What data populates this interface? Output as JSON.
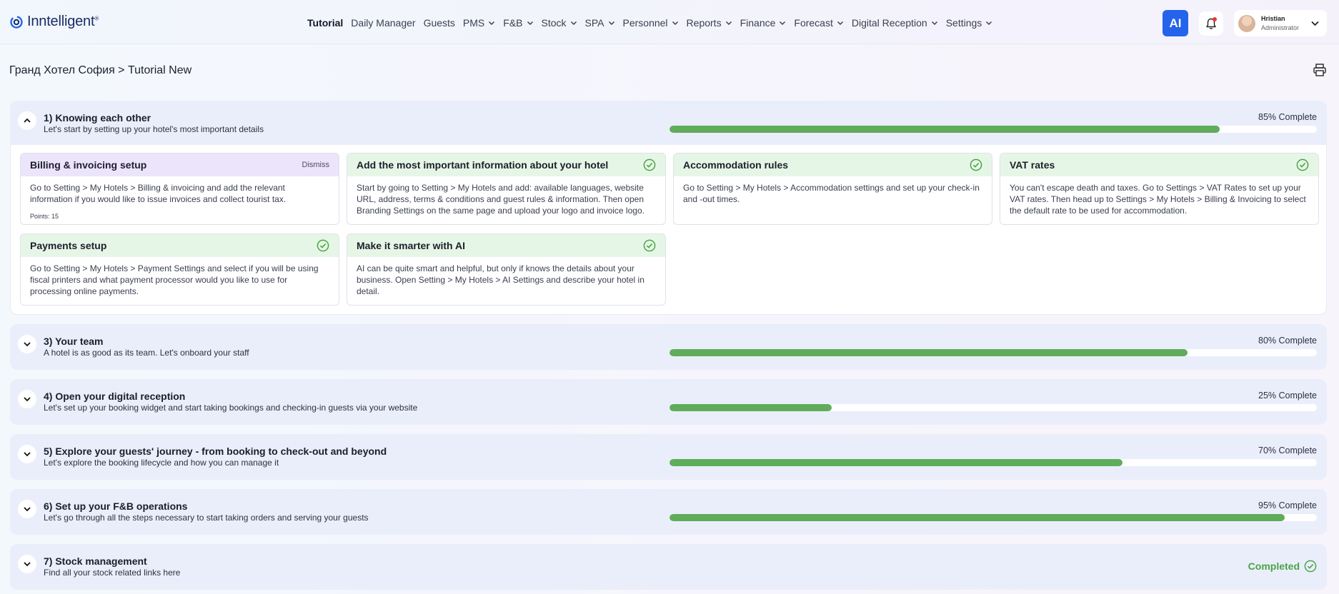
{
  "app": {
    "logo_text": "Inntelligent",
    "logo_mark": "®",
    "nav": [
      {
        "label": "Tutorial",
        "dropdown": false,
        "active": true
      },
      {
        "label": "Daily Manager",
        "dropdown": false
      },
      {
        "label": "Guests",
        "dropdown": false
      },
      {
        "label": "PMS",
        "dropdown": true
      },
      {
        "label": "F&B",
        "dropdown": true
      },
      {
        "label": "Stock",
        "dropdown": true
      },
      {
        "label": "SPA",
        "dropdown": true
      },
      {
        "label": "Personnel",
        "dropdown": true
      },
      {
        "label": "Reports",
        "dropdown": true
      },
      {
        "label": "Finance",
        "dropdown": true
      },
      {
        "label": "Forecast",
        "dropdown": true
      },
      {
        "label": "Digital Reception",
        "dropdown": true
      },
      {
        "label": "Settings",
        "dropdown": true
      }
    ],
    "ai_label": "AI",
    "user": {
      "name": "Hristian",
      "role": "Administrator"
    }
  },
  "page": {
    "breadcrumb": "Гранд Хотел София > Tutorial New"
  },
  "colors": {
    "progress_fill": "#5fac5b",
    "accent_blue": "#2563eb",
    "done_green": "#4aa546",
    "pending_purple": "#ece4fa"
  },
  "sections": [
    {
      "title": "1) Knowing each other",
      "subtitle": "Let's start by setting up your hotel's most important details",
      "progress_label": "85% Complete",
      "progress": 0.85,
      "expanded": true,
      "cards": [
        {
          "title": "Billing & invoicing setup",
          "body": "Go to Setting > My Hotels > Billing & invoicing and add the relevant information if you would like to issue invoices and collect tourist tax.",
          "points": "Points: 15",
          "dismiss": "Dismiss",
          "done": false
        },
        {
          "title": "Add the most important information about your hotel",
          "body": "Start by going to Setting > My Hotels and add: available languages, website URL, address, terms & conditions and guest rules & information. Then open Branding Settings on the same page and upload your logo and invoice logo.",
          "done": true
        },
        {
          "title": "Accommodation rules",
          "body": "Go to Setting > My Hotels > Accommodation settings and set up your check-in and -out times.",
          "done": true
        },
        {
          "title": "VAT rates",
          "body": "You can't escape death and taxes. Go to Settings > VAT Rates to set up your VAT rates. Then head up to Settings > My Hotels > Billing & Invoicing to select the default rate to be used for accommodation.",
          "done": true
        },
        {
          "title": "Payments setup",
          "body": "Go to Setting > My Hotels > Payment Settings and select if you will be using fiscal printers and what payment processor would you like to use for processing online payments.",
          "done": true
        },
        {
          "title": "Make it smarter with AI",
          "body": "AI can be quite smart and helpful, but only if knows the details about your business. Open Setting > My Hotels > AI Settings and describe your hotel in detail.",
          "done": true
        }
      ]
    },
    {
      "title": "3) Your team",
      "subtitle": "A hotel is as good as its team. Let's onboard your staff",
      "progress_label": "80% Complete",
      "progress": 0.8
    },
    {
      "title": "4) Open your digital reception",
      "subtitle": "Let's set up your booking widget and start taking bookings and checking-in guests via your website",
      "progress_label": "25% Complete",
      "progress": 0.25
    },
    {
      "title": "5) Explore your guests' journey - from booking to check-out and beyond",
      "subtitle": "Let's explore the booking lifecycle and how you can manage it",
      "progress_label": "70% Complete",
      "progress": 0.7
    },
    {
      "title": "6) Set up your F&B operations",
      "subtitle": "Let's go through all the steps necessary to start taking orders and serving your guests",
      "progress_label": "95% Complete",
      "progress": 0.95
    },
    {
      "title": "7) Stock management",
      "subtitle": "Find all your stock related links here",
      "completed_label": "Completed"
    }
  ]
}
